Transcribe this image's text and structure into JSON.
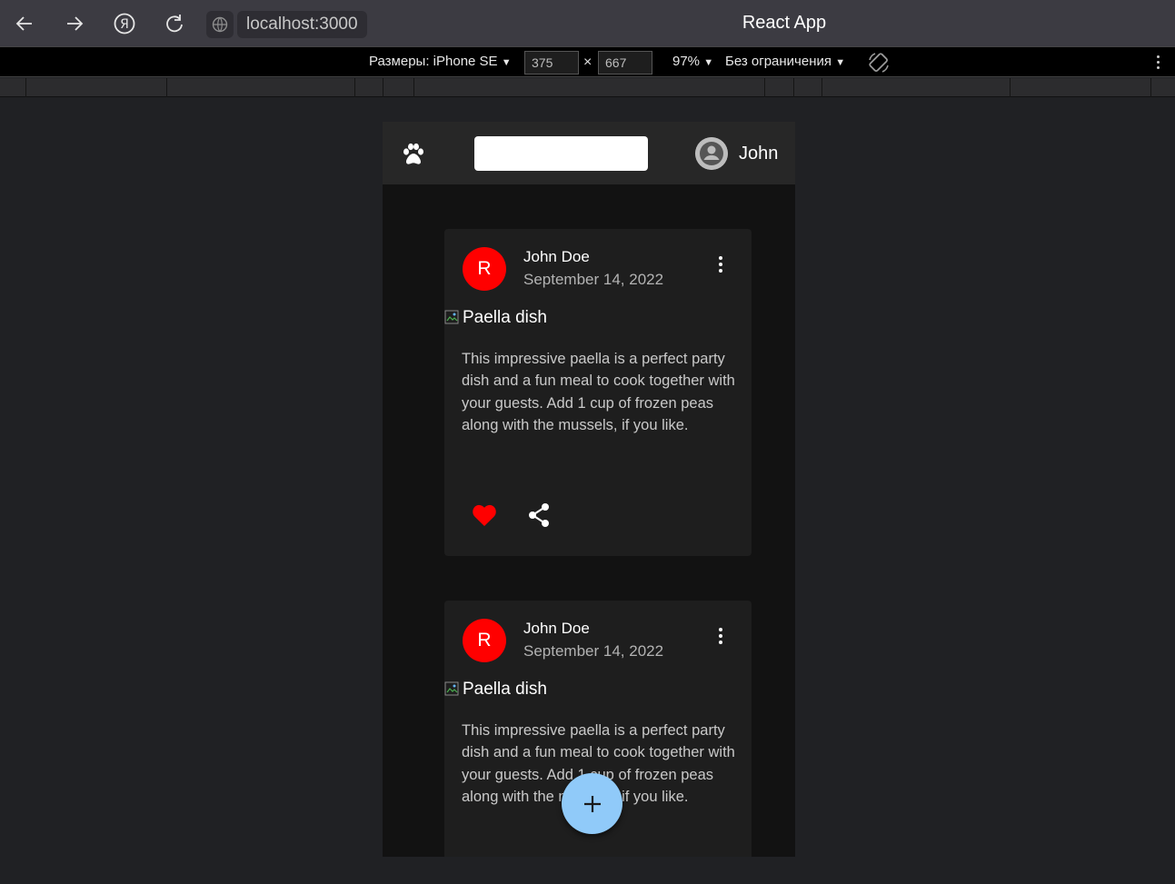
{
  "browser": {
    "url": "localhost:3000",
    "title": "React App"
  },
  "devtools": {
    "device_label": "Размеры: iPhone SE",
    "width": "375",
    "height": "667",
    "zoom": "97%",
    "throttling": "Без ограничения"
  },
  "app": {
    "search_placeholder": "",
    "user_name": "John",
    "posts": [
      {
        "avatar_letter": "R",
        "author": "John Doe",
        "date": "September 14, 2022",
        "image_alt": "Paella dish",
        "text": "This impressive paella is a perfect party dish and a fun meal to cook together with your guests. Add 1 cup of frozen peas along with the mussels, if you like.",
        "liked": true
      },
      {
        "avatar_letter": "R",
        "author": "John Doe",
        "date": "September 14, 2022",
        "image_alt": "Paella dish",
        "text": "This impressive paella is a perfect party dish and a fun meal to cook together with your guests. Add 1 cup of frozen peas along with the mussels, if you like.",
        "liked": true
      }
    ],
    "fab_label": "+"
  },
  "colors": {
    "avatar_bg": "#ff0000",
    "like": "#ff0000",
    "fab": "#90caf9",
    "appbar": "#272727",
    "card": "#1e1e1e"
  },
  "icons": [
    "back-arrow-icon",
    "forward-arrow-icon",
    "yandex-icon",
    "reload-icon",
    "globe-icon",
    "rotate-icon",
    "paw-icon",
    "account-circle-icon",
    "more-vert-icon",
    "favorite-icon",
    "share-icon",
    "add-icon"
  ]
}
